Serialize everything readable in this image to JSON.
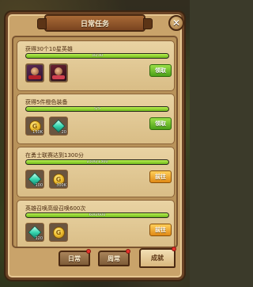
{
  "title": "日常任务",
  "close_label": "✕",
  "tasks": [
    {
      "title": "获得30个10星英雄",
      "progress_text": "30/30",
      "progress": 1.0,
      "rewards": [
        {
          "type": "hero-card",
          "qty": ""
        },
        {
          "type": "hero-card",
          "qty": ""
        }
      ],
      "button": "领取",
      "button_style": "green"
    },
    {
      "title": "获得5件橙色装备",
      "progress_text": "5/5",
      "progress": 1.0,
      "rewards": [
        {
          "type": "coin",
          "qty": "150K"
        },
        {
          "type": "gem",
          "qty": "20"
        }
      ],
      "button": "领取",
      "button_style": "green"
    },
    {
      "title": "在勇士联赛达到1300分",
      "progress_text": "1300/1300",
      "progress": 1.0,
      "rewards": [
        {
          "type": "gem",
          "qty": "100"
        },
        {
          "type": "coin",
          "qty": "300K"
        }
      ],
      "button": "前往",
      "button_style": "orange"
    },
    {
      "title": "英雄召唤高级召唤600次",
      "progress_text": "600/600",
      "progress": 1.0,
      "rewards": [
        {
          "type": "gem",
          "qty": "120"
        },
        {
          "type": "coin",
          "qty": ""
        }
      ],
      "button": "前往",
      "button_style": "orange"
    }
  ],
  "tabs": [
    {
      "label": "日常",
      "active": false
    },
    {
      "label": "周常",
      "active": false
    },
    {
      "label": "成就",
      "active": true
    }
  ]
}
